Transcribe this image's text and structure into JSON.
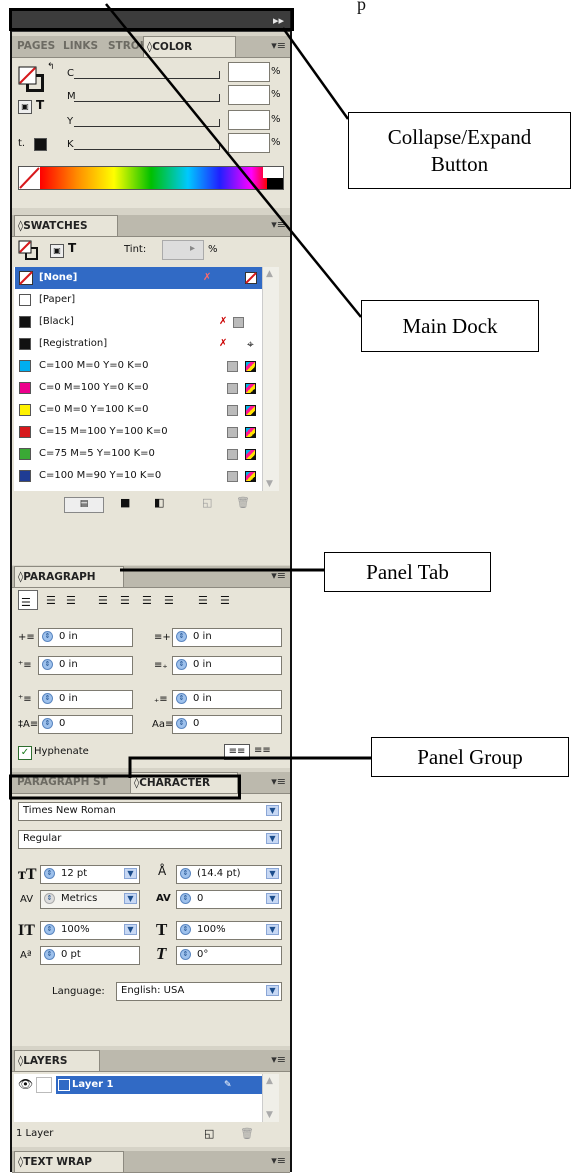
{
  "top_caption": "p",
  "dock": {
    "collapse_label": "▸▸",
    "color_panel": {
      "tabs": [
        "PAGES",
        "LINKS",
        "STROK",
        "◊COLOR"
      ],
      "channels": [
        {
          "label": "C",
          "value": "",
          "unit": "%"
        },
        {
          "label": "M",
          "value": "",
          "unit": "%"
        },
        {
          "label": "Y",
          "value": "",
          "unit": "%"
        },
        {
          "label": "K",
          "value": "",
          "unit": "%"
        }
      ],
      "t_label": "T",
      "menu": "▾≡"
    },
    "swatches": {
      "tab": "◊SWATCHES",
      "tint_label": "Tint:",
      "tint_value": "",
      "tint_unit": "%",
      "t_label": "T",
      "menu": "▾≡",
      "items": [
        {
          "name": "[None]",
          "color": "#ffffff",
          "selected": true
        },
        {
          "name": "[Paper]",
          "color": "#ffffff",
          "selected": false
        },
        {
          "name": "[Black]",
          "color": "#111111",
          "selected": false
        },
        {
          "name": "[Registration]",
          "color": "#111111",
          "selected": false
        },
        {
          "name": "C=100 M=0 Y=0 K=0",
          "color": "#00aeef",
          "selected": false
        },
        {
          "name": "C=0 M=100 Y=0 K=0",
          "color": "#ec008c",
          "selected": false
        },
        {
          "name": "C=0 M=0 Y=100 K=0",
          "color": "#fff200",
          "selected": false
        },
        {
          "name": "C=15 M=100 Y=100 K=0",
          "color": "#d7191c",
          "selected": false
        },
        {
          "name": "C=75 M=5 Y=100 K=0",
          "color": "#3aa935",
          "selected": false
        },
        {
          "name": "C=100 M=90 Y=10 K=0",
          "color": "#1f3c94",
          "selected": false
        }
      ]
    },
    "paragraph": {
      "tab": "◊PARAGRAPH",
      "menu": "▾≡",
      "fields": [
        {
          "value": "0 in"
        },
        {
          "value": "0 in"
        },
        {
          "value": "0 in"
        },
        {
          "value": "0 in"
        },
        {
          "value": "0 in"
        },
        {
          "value": "0 in"
        },
        {
          "value": "0"
        },
        {
          "value": "0"
        }
      ],
      "hyphenate_label": "Hyphenate",
      "hyphenate_checked": true
    },
    "character": {
      "tabs": [
        "PARAGRAPH ST",
        "◊CHARACTER"
      ],
      "menu": "▾≡",
      "font_family": "Times New Roman",
      "font_style": "Regular",
      "size": "12 pt",
      "leading": "(14.4 pt)",
      "kerning": "Metrics",
      "tracking": "0",
      "vscale": "100%",
      "hscale": "100%",
      "baseline": "0 pt",
      "skew": "0°",
      "language_label": "Language:",
      "language": "English: USA"
    },
    "layers": {
      "tab": "◊LAYERS",
      "menu": "▾≡",
      "layer_name": "Layer 1",
      "count": "1 Layer"
    },
    "text_wrap": {
      "tab": "◊TEXT WRAP",
      "menu": "▾≡"
    }
  },
  "callouts": {
    "collapse": [
      "Collapse/Expand",
      "Button"
    ],
    "main_dock": "Main Dock",
    "panel_tab": "Panel Tab",
    "panel_group": "Panel Group"
  }
}
